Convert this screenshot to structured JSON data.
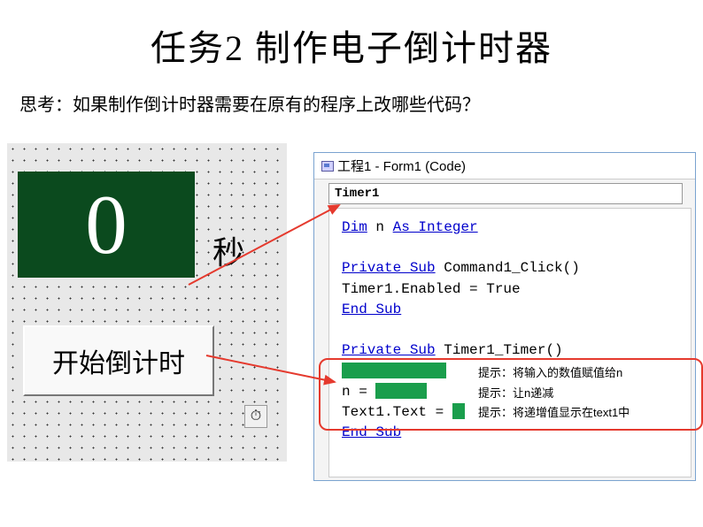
{
  "title": "任务2  制作电子倒计时器",
  "question": "思考：如果制作倒计时器需要在原有的程序上改哪些代码？",
  "form": {
    "display_value": "0",
    "seconds_label": "秒",
    "start_button": "开始倒计时",
    "timer_glyph": "⏱"
  },
  "code_window": {
    "title": "工程1 - Form1 (Code)",
    "dropdown": "Timer1",
    "lines": {
      "l1a": "Dim",
      "l1b": " n ",
      "l1c": "As Integer",
      "l2a": "Private Sub",
      "l2b": " Command1_Click()",
      "l3": "Timer1.Enabled = True",
      "l4": "End Sub",
      "l5a": "Private Sub",
      "l5b": " Timer1_Timer()",
      "l6": "n = ",
      "l7": "Text1.Text = ",
      "l8": "End Sub"
    }
  },
  "hints": {
    "h1": "提示：将输入的数值赋值给n",
    "h2": "提示：让n递减",
    "h3": "提示：将递增值显示在text1中"
  }
}
